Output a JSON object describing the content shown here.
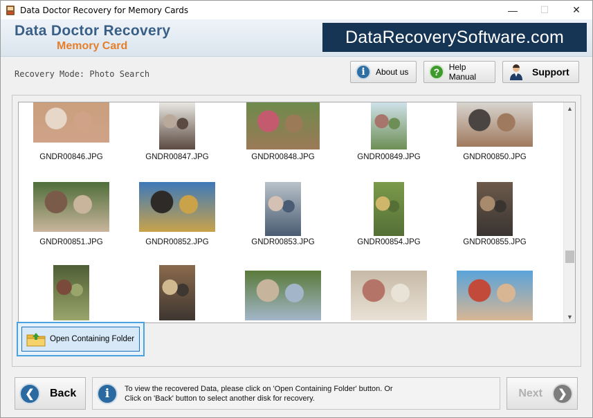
{
  "window": {
    "title": "Data Doctor Recovery for Memory Cards",
    "minimize": "—",
    "maximize": "☐",
    "close": "✕"
  },
  "header": {
    "brand_line1": "Data Doctor Recovery",
    "brand_line2": "Memory Card",
    "site": "DataRecoverySoftware.com"
  },
  "toolbar": {
    "mode_label": "Recovery Mode: Photo Search",
    "about_label": "About us",
    "help_label": "Help Manual",
    "support_label": "Support"
  },
  "gallery": {
    "items": [
      {
        "name": "GNDR00846.JPG",
        "colors": [
          "#c99f7e",
          "#e6d7c8",
          "#d0a388"
        ]
      },
      {
        "name": "GNDR00847.JPG",
        "colors": [
          "#e9e7e2",
          "#b9a99b",
          "#5b4a41"
        ]
      },
      {
        "name": "GNDR00848.JPG",
        "colors": [
          "#6e8a4b",
          "#c45a6e",
          "#9b7a58"
        ]
      },
      {
        "name": "GNDR00849.JPG",
        "colors": [
          "#cfe1e9",
          "#a8756d",
          "#6d8f55"
        ]
      },
      {
        "name": "GNDR00850.JPG",
        "colors": [
          "#d8d5d0",
          "#4a4442",
          "#a07a5e"
        ]
      },
      {
        "name": "GNDR00851.JPG",
        "colors": [
          "#4f6e3a",
          "#7a5a48",
          "#c9b59c"
        ]
      },
      {
        "name": "GNDR00852.JPG",
        "colors": [
          "#3d79b9",
          "#2e2a28",
          "#c9a24a"
        ]
      },
      {
        "name": "GNDR00853.JPG",
        "colors": [
          "#b8c2c9",
          "#d5c0b4",
          "#4a5c73"
        ]
      },
      {
        "name": "GNDR00854.JPG",
        "colors": [
          "#7b9a4a",
          "#d0b66b",
          "#556f36"
        ]
      },
      {
        "name": "GNDR00855.JPG",
        "colors": [
          "#6c5a4b",
          "#a88b6d",
          "#3a3431"
        ]
      },
      {
        "name": "",
        "colors": [
          "#4f5f35",
          "#7a4a3b",
          "#9aa56b"
        ]
      },
      {
        "name": "",
        "colors": [
          "#8a6a4c",
          "#d0b98e",
          "#3e3631"
        ]
      },
      {
        "name": "",
        "colors": [
          "#5a7a3a",
          "#c6b59c",
          "#a3b6c9"
        ]
      },
      {
        "name": "",
        "colors": [
          "#c7b9a6",
          "#b57468",
          "#e9e2d6"
        ]
      },
      {
        "name": "",
        "colors": [
          "#5aa3d9",
          "#c14a3a",
          "#d8b694"
        ]
      }
    ]
  },
  "open_folder": {
    "label": "Open Containing Folder"
  },
  "footer": {
    "back_label": "Back",
    "next_label": "Next",
    "info_line1": "To view the recovered Data, please click on 'Open Containing Folder' button. Or",
    "info_line2": "Click on 'Back' button to select another disk for recovery."
  }
}
